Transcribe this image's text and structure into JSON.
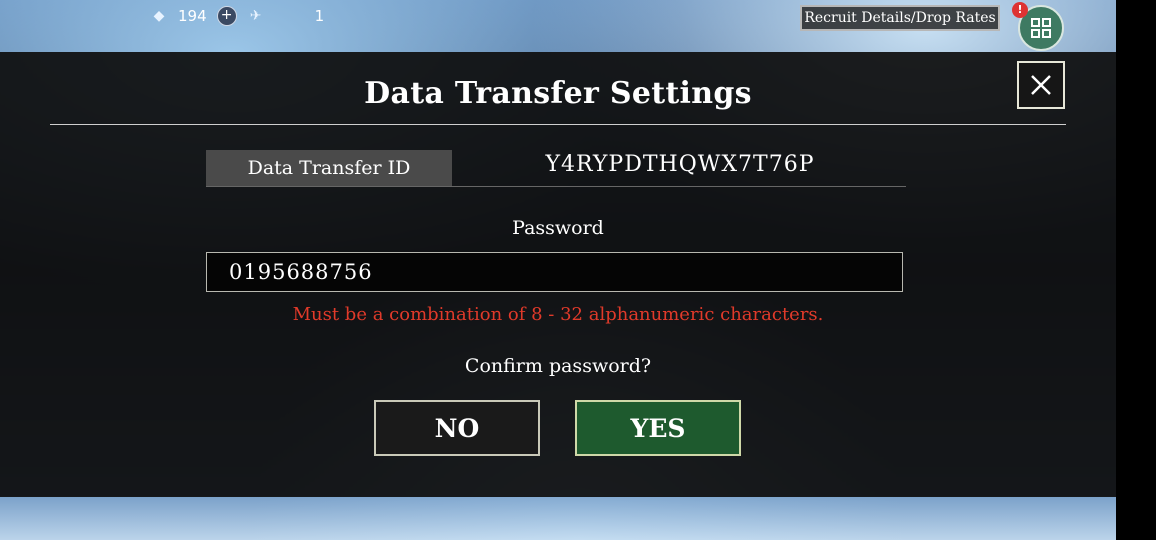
{
  "hud": {
    "currency_count": "194",
    "ticket_count": "1",
    "recruit_details_label": "Recruit Details/Drop Rates",
    "alert_mark": "!"
  },
  "dialog": {
    "title": "Data Transfer Settings",
    "close_symbol": "✕",
    "transfer_id_label": "Data Transfer ID",
    "transfer_id_value": "Y4RYPDTHQWX7T76P",
    "password_label": "Password",
    "password_value": "0195688756",
    "error_message": "Must be a combination of 8 - 32 alphanumeric characters.",
    "confirm_prompt": "Confirm password?",
    "no_label": "NO",
    "yes_label": "YES"
  },
  "colors": {
    "error": "#e03a2a",
    "yes_button": "#1e5a2e",
    "panel": "#0e0e0e"
  }
}
